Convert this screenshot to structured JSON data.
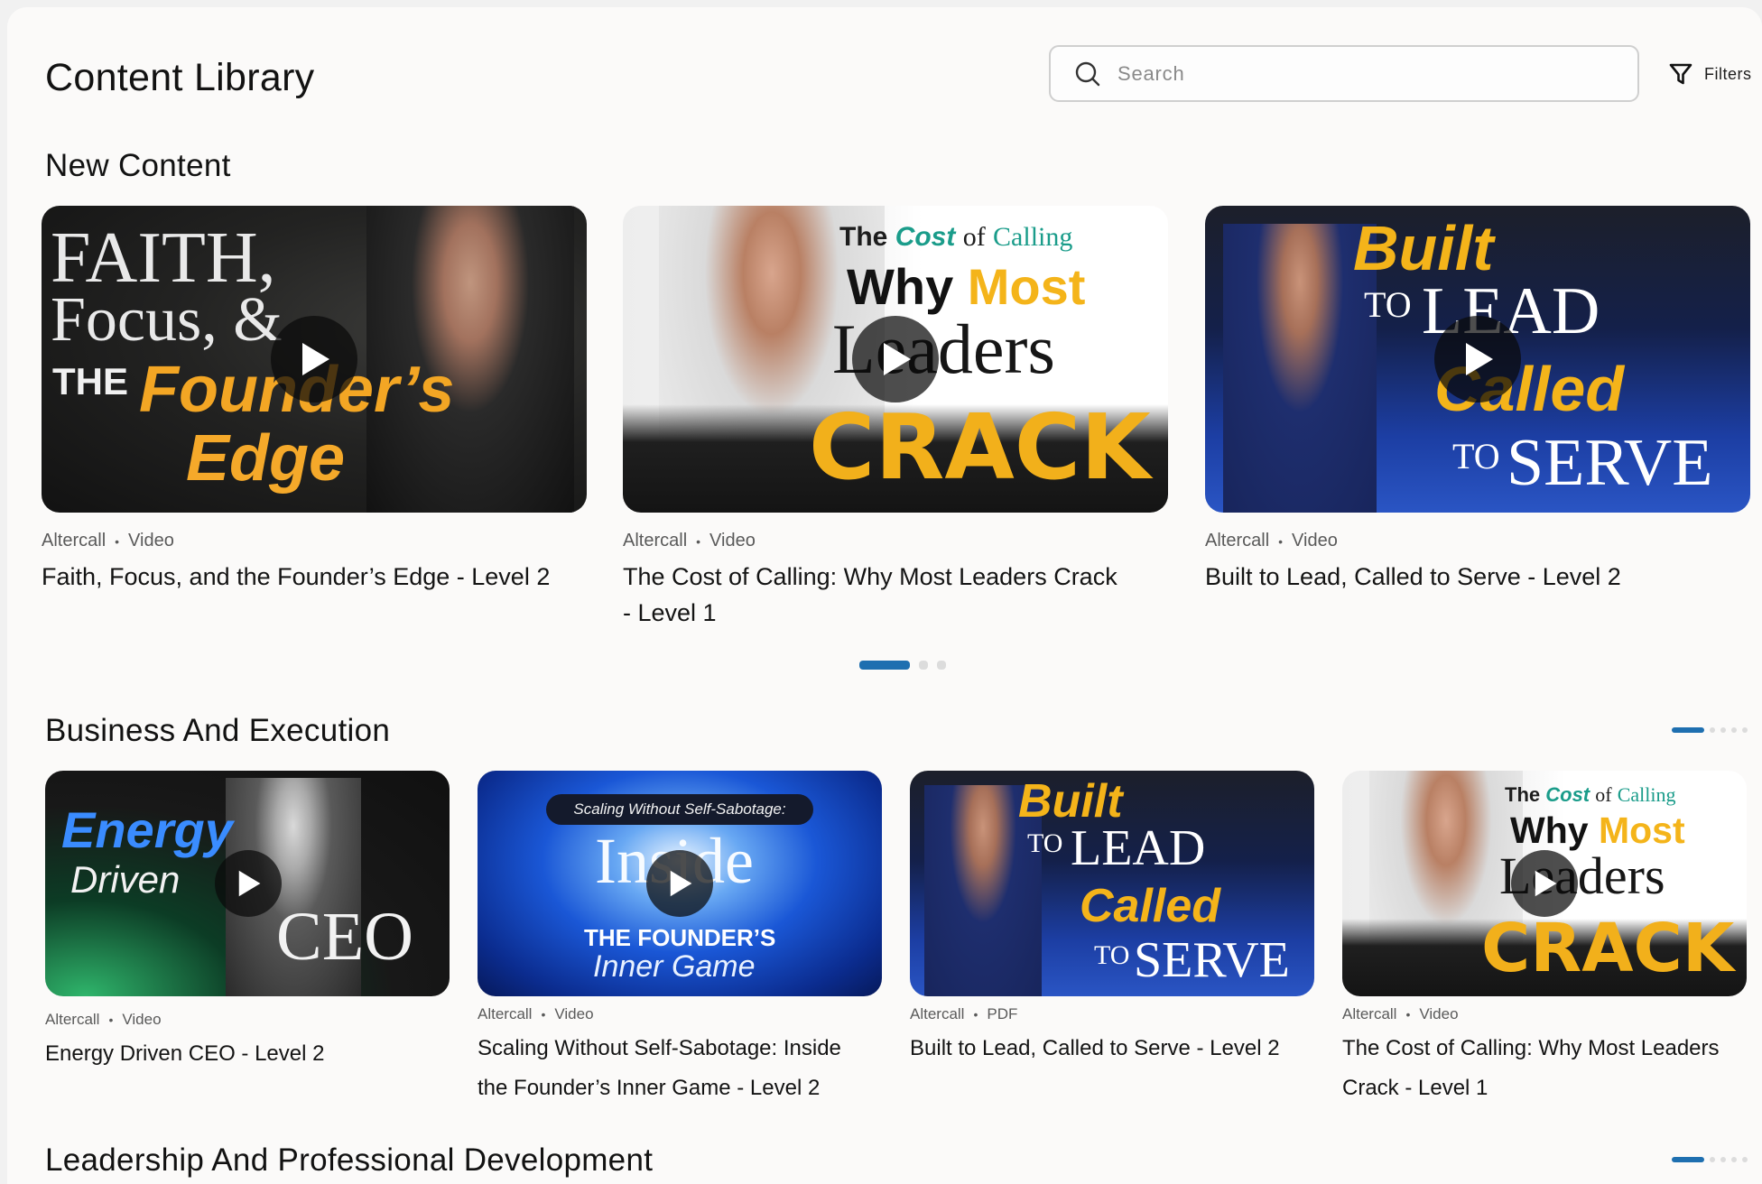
{
  "header": {
    "title": "Content Library",
    "search_placeholder": "Search",
    "filters_label": "Filters"
  },
  "icons": {
    "search": "search-icon",
    "filter": "filter-funnel-icon",
    "play": "play-icon"
  },
  "colors": {
    "accent": "#1e6fb0",
    "gold": "#f4b41a"
  },
  "sections": {
    "new_content": {
      "title": "New Content",
      "cards": [
        {
          "provider": "Altercall",
          "type": "Video",
          "title_line1": "Faith, Focus, and the Founder’s Edge - Level 2",
          "title_line2": "",
          "thumb": {
            "l1": "FAITH,",
            "l2": "Focus, &",
            "l3": "THE",
            "l4": "Founder’s",
            "l5": "Edge"
          }
        },
        {
          "provider": "Altercall",
          "type": "Video",
          "title_line1": "The Cost of Calling: Why Most Leaders Crack",
          "title_line2": "- Level 1",
          "thumb": {
            "l1": "The",
            "l2": "Cost",
            "l3": "of",
            "l4": "Calling",
            "l5": "Why",
            "l6": "Most",
            "l7": "Leaders",
            "l8": "CRACK"
          }
        },
        {
          "provider": "Altercall",
          "type": "Video",
          "title_line1": "Built to Lead, Called to Serve - Level 2",
          "title_line2": "",
          "thumb": {
            "l1": "Built",
            "l2": "TO",
            "l3": "LEAD",
            "l4": "Called",
            "l5": "TO",
            "l6": "SERVE"
          }
        }
      ],
      "pagination": {
        "count": 3,
        "active": 0
      }
    },
    "business": {
      "title": "Business And Execution",
      "cards": [
        {
          "provider": "Altercall",
          "type": "Video",
          "title_line1": "Energy Driven CEO - Level 2",
          "title_line2": "",
          "thumb": {
            "l1": "Energy",
            "l2": "Driven",
            "l3": "CEO"
          }
        },
        {
          "provider": "Altercall",
          "type": "Video",
          "title_line1": "Scaling Without Self-Sabotage: Inside",
          "title_line2": "the Founder’s Inner Game - Level 2",
          "thumb": {
            "pill": "Scaling Without Self-Sabotage:",
            "l1": "Inside",
            "l2": "THE FOUNDER’S",
            "l3": "Inner Game"
          }
        },
        {
          "provider": "Altercall",
          "type": "PDF",
          "title_line1": "Built to Lead, Called to Serve - Level 2",
          "title_line2": "",
          "thumb": {
            "l1": "Built",
            "l2": "TO",
            "l3": "LEAD",
            "l4": "Called",
            "l5": "TO",
            "l6": "SERVE"
          }
        },
        {
          "provider": "Altercall",
          "type": "Video",
          "title_line1": "The Cost of Calling: Why Most Leaders",
          "title_line2": "Crack - Level 1",
          "thumb": {
            "l1": "The",
            "l2": "Cost",
            "l3": "of",
            "l4": "Calling",
            "l5": "Why",
            "l6": "Most",
            "l7": "Leaders",
            "l8": "CRACK"
          }
        }
      ],
      "pagination": {
        "count": 5,
        "active": 0
      }
    },
    "leadership": {
      "title": "Leadership And Professional Development",
      "pagination": {
        "count": 5,
        "active": 0
      }
    }
  }
}
